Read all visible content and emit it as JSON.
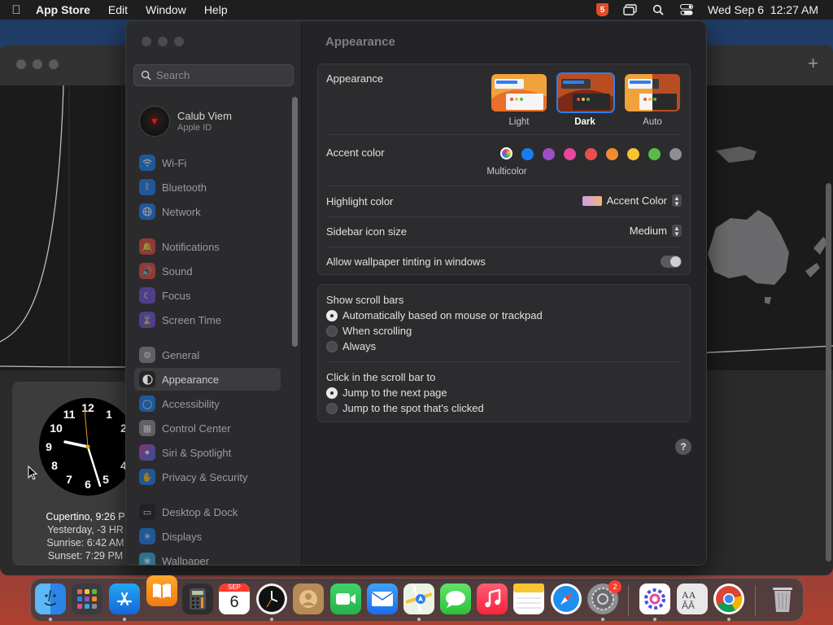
{
  "menubar": {
    "app_name": "App Store",
    "menus": [
      "Edit",
      "Window",
      "Help"
    ],
    "clock": "Wed Sep 6  12:27 AM"
  },
  "world_clock": {
    "city_line": "Cupertino, 9:26 P",
    "day_line": "Yesterday, -3 HR",
    "sunrise_line": "Sunrise: 6:42 AM",
    "sunset_line": "Sunset: 7:29 PM",
    "numbers": [
      "12",
      "1",
      "2",
      "4",
      "5",
      "6",
      "7",
      "8",
      "9",
      "10",
      "11"
    ]
  },
  "settings": {
    "search_placeholder": "Search",
    "account": {
      "name": "Calub Viem",
      "subtitle": "Apple ID"
    },
    "sidebar": [
      {
        "label": "Wi-Fi",
        "icon": "wifi-icon",
        "color": "#1a7cf0"
      },
      {
        "label": "Bluetooth",
        "icon": "bluetooth-icon",
        "color": "#1a7cf0"
      },
      {
        "label": "Network",
        "icon": "globe-icon",
        "color": "#1a7cf0"
      },
      {
        "label": "Notifications",
        "icon": "bell-icon",
        "color": "#e5463f"
      },
      {
        "label": "Sound",
        "icon": "speaker-icon",
        "color": "#e5463f"
      },
      {
        "label": "Focus",
        "icon": "moon-icon",
        "color": "#6d4ed6"
      },
      {
        "label": "Screen Time",
        "icon": "hourglass-icon",
        "color": "#6d4ed6"
      },
      {
        "label": "General",
        "icon": "gear-icon",
        "color": "#8e8e93"
      },
      {
        "label": "Appearance",
        "icon": "appearance-icon",
        "color": "#1c1c1e"
      },
      {
        "label": "Accessibility",
        "icon": "accessibility-icon",
        "color": "#1a7cf0"
      },
      {
        "label": "Control Center",
        "icon": "control-center-icon",
        "color": "#8e8e93"
      },
      {
        "label": "Siri & Spotlight",
        "icon": "siri-icon",
        "color": "#c63fb0"
      },
      {
        "label": "Privacy & Security",
        "icon": "hand-icon",
        "color": "#1a7cf0"
      },
      {
        "label": "Desktop & Dock",
        "icon": "desktop-icon",
        "color": "#1c1c1e"
      },
      {
        "label": "Displays",
        "icon": "sun-icon",
        "color": "#1a7cf0"
      },
      {
        "label": "Wallpaper",
        "icon": "wallpaper-icon",
        "color": "#34aadc"
      }
    ],
    "main": {
      "title": "Appearance",
      "appearance_label": "Appearance",
      "appearance_options": [
        "Light",
        "Dark",
        "Auto"
      ],
      "appearance_selected": "Dark",
      "accent_label": "Accent color",
      "accent_colors": [
        "multicolor",
        "#1a7cf0",
        "#9a4fc5",
        "#e8479c",
        "#ea4d4f",
        "#f08d30",
        "#f7c531",
        "#5bb946",
        "#8e8e93"
      ],
      "accent_caption": "Multicolor",
      "highlight_label": "Highlight color",
      "highlight_value": "Accent Color",
      "sidebar_icon_label": "Sidebar icon size",
      "sidebar_icon_value": "Medium",
      "tinting_label": "Allow wallpaper tinting in windows",
      "scroll_bars_label": "Show scroll bars",
      "scroll_bar_options": [
        "Automatically based on mouse or trackpad",
        "When scrolling",
        "Always"
      ],
      "click_label": "Click in the scroll bar to",
      "click_options": [
        "Jump to the next page",
        "Jump to the spot that's clicked"
      ],
      "help": "?"
    }
  },
  "dock": {
    "calendar_month": "SEP",
    "calendar_day": "6",
    "settings_badge": "2"
  }
}
